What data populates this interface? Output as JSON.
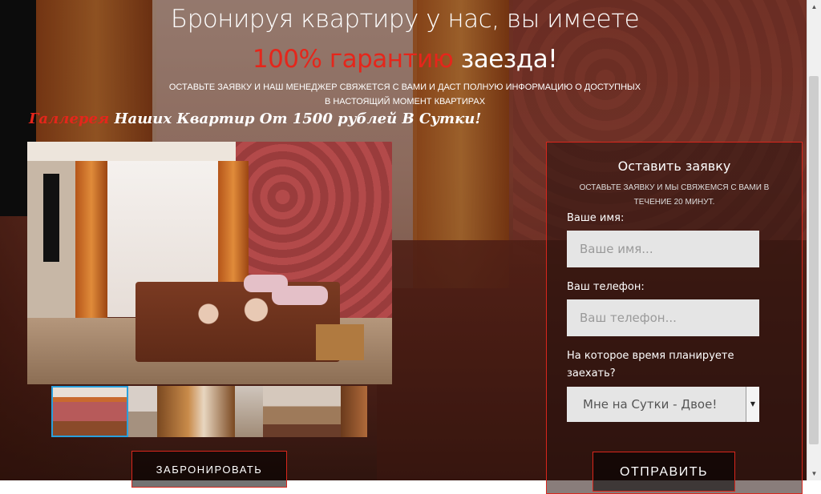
{
  "header": {
    "headline_line1": "Бронируя квартиру у нас, вы имеете",
    "headline_red": "100% гарантию",
    "headline_rest": " заезда!",
    "subtext": "Оставьте заявку и наш менеджер свяжется с вами и даст полную информацию о доступных в настоящий момент квартирах"
  },
  "gallery": {
    "title_red": "Галлерея",
    "title_rest": " Наших Квартир От 1500 рублей В Сутки!",
    "book_button": "ЗАБРОНИРОВАТЬ",
    "thumb_count": 5,
    "selected_index": 0
  },
  "form": {
    "title": "Оставить заявку",
    "subtitle": "Оставьте заявку и мы свяжемся с вами в течение 20 минут.",
    "name_label": "Ваше имя:",
    "name_placeholder": "Ваше имя...",
    "phone_label": "Ваш телефон:",
    "phone_placeholder": "Ваш телефон...",
    "time_label": "На которое время планируете заехать?",
    "time_selected": "Мне на Сутки - Двое!",
    "submit": "ОТПРАВИТЬ"
  },
  "colors": {
    "accent": "#e5261b",
    "thumb_selected_border": "#29a0dd"
  },
  "icons": {
    "scroll_up": "▲",
    "scroll_down": "▼",
    "select_arrow": "▼"
  }
}
